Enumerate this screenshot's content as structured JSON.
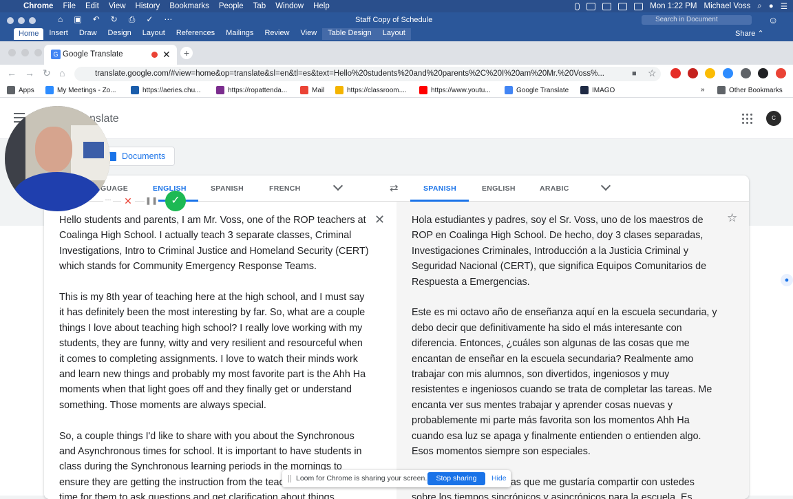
{
  "mac_menu": {
    "items": [
      "Chrome",
      "File",
      "Edit",
      "View",
      "History",
      "Bookmarks",
      "People",
      "Tab",
      "Window",
      "Help"
    ],
    "clock": "Mon 1:22 PM",
    "user": "Michael Voss"
  },
  "word": {
    "doc_title": "Staff Copy of Schedule",
    "search_placeholder": "Search in Document",
    "tabs": [
      "Home",
      "Insert",
      "Draw",
      "Design",
      "Layout",
      "References",
      "Mailings",
      "Review",
      "View",
      "Table Design",
      "Layout"
    ],
    "share": "Share"
  },
  "browser": {
    "tab_title": "Google Translate",
    "url": "translate.google.com/#view=home&op=translate&sl=en&tl=es&text=Hello%20students%20and%20parents%2C%20I%20am%20Mr.%20Voss%...",
    "bookmarks": [
      "Apps",
      "My Meetings - Zo...",
      "https://aeries.chu...",
      "https://ropattenda...",
      "Mail",
      "https://classroom....",
      "https://www.youtu...",
      "Google Translate",
      "IMAGO"
    ],
    "other_bookmarks": "Other Bookmarks"
  },
  "translate": {
    "title": "Google Translate",
    "title_visible": "nslate",
    "profile_initials": "C",
    "documents_button": "Documents",
    "source_langs": [
      "DETECT LANGUAGE",
      "ENGLISH",
      "SPANISH",
      "FRENCH"
    ],
    "source_langs_visible": [
      "GUAGE",
      "ENGLISH",
      "SPANISH",
      "FRENCH"
    ],
    "target_langs": [
      "SPANISH",
      "ENGLISH",
      "ARABIC"
    ],
    "source_text": [
      "Hello students and parents, I am Mr. Voss, one of the ROP teachers at Coalinga High School. I actually teach 3 separate classes, Criminal Investigations, Intro to Criminal Justice and Homeland Security (CERT) which stands for Community Emergency Response Teams.",
      "This is my 8th year of teaching here at the high school, and I must say it has definitely been the most interesting by far. So, what are a couple things I love about teaching high school? I really love working with my students, they are funny, witty and very resilient and resourceful when it comes to completing assignments. I love to watch their minds work and learn new things and probably my most favorite part is the Ahh Ha moments when that light goes off and they finally get or understand something. Those moments are always special.",
      "So, a couple things I'd like to share with you about the Synchronous and Asynchronous times for school. It is important to have students in class during the Synchronous learning periods in the mornings to ensure they are getting the instruction from the teacher as well as the time for them to ask questions and get clarification about things."
    ],
    "translated_text": [
      "Hola estudiantes y padres, soy el Sr. Voss, uno de los maestros de ROP en Coalinga High School. De hecho, doy 3 clases separadas, Investigaciones Criminales, Introducción a la Justicia Criminal y Seguridad Nacional (CERT), que significa Equipos Comunitarios de Respuesta a Emergencias.",
      "Este es mi octavo año de enseñanza aquí en la escuela secundaria, y debo decir que definitivamente ha sido el más interesante con diferencia. Entonces, ¿cuáles son algunas de las cosas que me encantan de enseñar en la escuela secundaria? Realmente amo trabajar con mis alumnos, son divertidos, ingeniosos y muy resistentes e ingeniosos cuando se trata de completar las tareas. Me encanta ver sus mentes trabajar y aprender cosas nuevas y probablemente mi parte más favorita son los momentos Ahh Ha cuando esa luz se apaga y finalmente entienden o entienden algo. Esos momentos siempre son especiales.",
      "Entonces, algunas cosas que me gustaría compartir con ustedes sobre los tiempos sincrónicos y asincrónicos para la escuela. Es"
    ]
  },
  "loom": {
    "share_message": "Loom for Chrome is sharing your screen.",
    "stop_label": "Stop sharing",
    "hide_label": "Hide"
  }
}
